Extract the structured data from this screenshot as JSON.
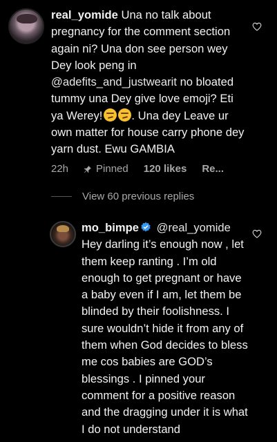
{
  "comment1": {
    "username": "real_yomide",
    "text_part1": " Una no talk about pregnancy for the comment section again ni? Una don see person wey Dey look peng in ",
    "mention": "@adefits_and_justwearit",
    "text_part2": " no bloated tummy una Dey give love emoji? Eti ya Werey!",
    "text_part3": ". Una dey Leave ur own matter for house carry phone dey yarn dust. Ewu GAMBIA",
    "time": "22h",
    "pinned_label": "Pinned",
    "likes": "120 likes",
    "reply_label": "Re..."
  },
  "view_replies": "View 60 previous replies",
  "comment2": {
    "username": "mo_bimpe",
    "mention": "@real_yomide",
    "text": " Hey darling it’s enough now , let them keep ranting . I’m old enough to get pregnant or have a baby even if I am, let them be blinded by their foolishness. I sure wouldn’t hide it from any of them when God decides to bless me cos babies are GOD’s blessings . I pinned your comment for a positive reason and the dragging under it is what I do not understand"
  },
  "icons": {
    "heart": "heart-outline-icon",
    "pin": "pin-icon",
    "verified": "verified-badge-icon",
    "emoji": "smirk-emoji"
  },
  "colors": {
    "background": "#000000",
    "text": "#f2f2f2",
    "secondary": "#a8a8a8",
    "verified": "#3897f0"
  }
}
